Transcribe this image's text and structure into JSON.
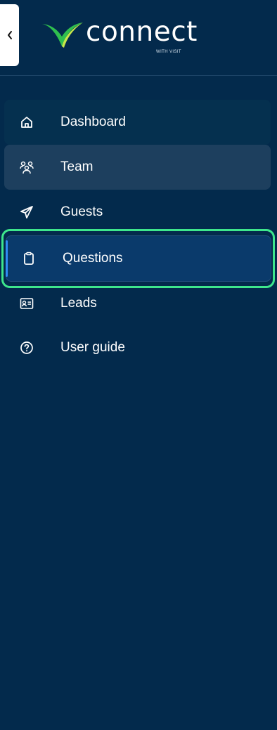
{
  "brand": {
    "name": "connect",
    "tagline": "WITH VISIT",
    "accent_color": "#2fbf4e"
  },
  "collapse_button": {
    "glyph": "‹",
    "icon": "chevron-left-icon"
  },
  "nav": {
    "items": [
      {
        "label": "Dashboard",
        "icon": "home-icon"
      },
      {
        "label": "Team",
        "icon": "users-icon"
      },
      {
        "label": "Guests",
        "icon": "send-icon"
      },
      {
        "label": "Questions",
        "icon": "clipboard-icon",
        "active": true
      },
      {
        "label": "Leads",
        "icon": "id-card-icon"
      },
      {
        "label": "User guide",
        "icon": "help-circle-icon"
      }
    ]
  },
  "colors": {
    "background": "#032a4c",
    "active_item": "#0a3a6b",
    "hover_item": "#1d3f5e",
    "highlight_outline": "#3ee68c"
  }
}
